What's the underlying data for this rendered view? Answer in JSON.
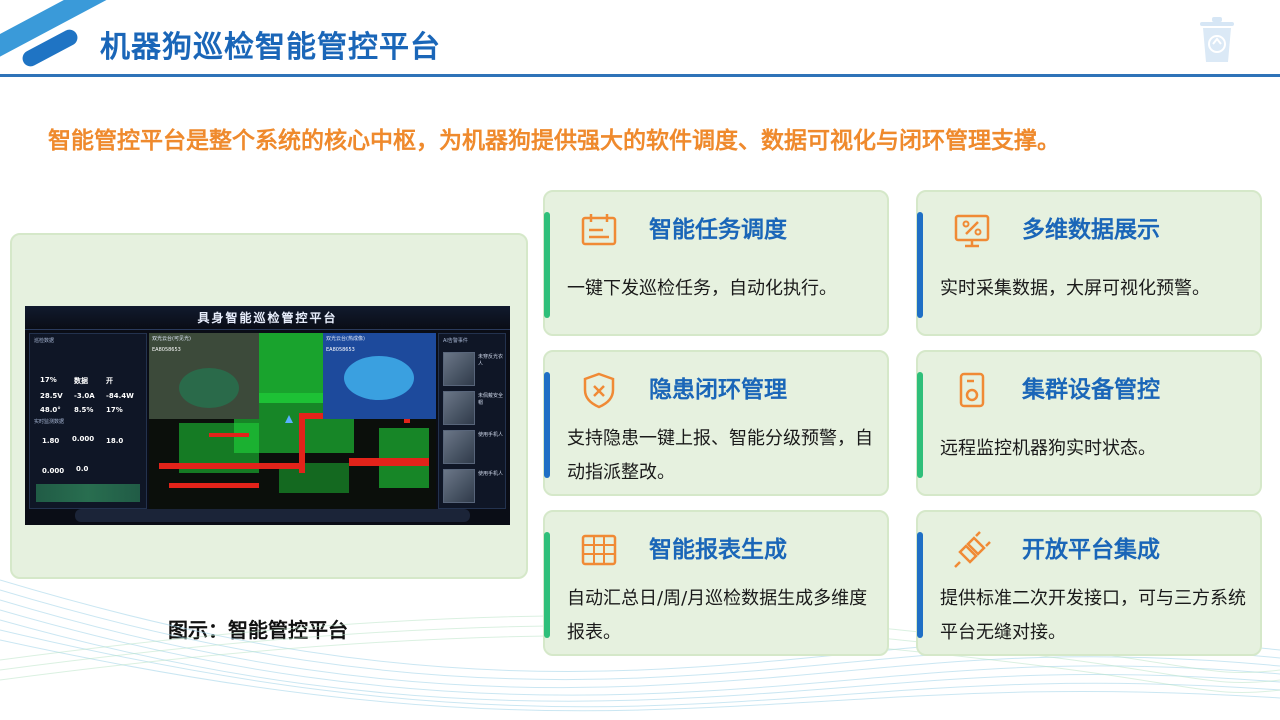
{
  "header": {
    "title": "机器狗巡检智能管控平台"
  },
  "subtitle": "智能管控平台是整个系统的核心中枢，为机器狗提供强大的软件调度、数据可视化与闭环管理支撑。",
  "figure": {
    "caption": "图示：智能管控平台",
    "dashboard_title": "具身智能巡检管控平台",
    "left_panel": {
      "section1": "巡检数据",
      "section2": "实时监测数据",
      "stat_values": [
        "17%",
        "数据",
        "开",
        "28.5V",
        "-3.0A",
        "-84.4W",
        "48.0°",
        "8.5%",
        "17%"
      ],
      "gas_values": [
        "1.80",
        "0.000",
        "18.0",
        "0.000",
        "0.0"
      ]
    },
    "cameras": [
      {
        "label": "双光云台(可见光)",
        "id": "EA8058653"
      },
      {
        "label": "双光云台(热成像)",
        "id": "EA8058653"
      }
    ],
    "alarm_panel": {
      "title": "AI告警事件",
      "items": [
        "未穿反光衣人",
        "未佩戴安全帽",
        "使用手机人",
        "使用手机人"
      ]
    }
  },
  "cards": [
    {
      "icon": "calendar-icon",
      "title": "智能任务调度",
      "desc": "一键下发巡检任务，自动化执行。",
      "accent": "#2fbf7a"
    },
    {
      "icon": "monitor-chart-icon",
      "title": "多维数据展示",
      "desc": "实时采集数据，大屏可视化预警。",
      "accent": "#1f6fc5"
    },
    {
      "icon": "shield-x-icon",
      "title": "隐患闭环管理",
      "desc": "支持隐患一键上报、智能分级预警，自动指派整改。",
      "accent": "#1f6fc5"
    },
    {
      "icon": "device-icon",
      "title": "集群设备管控",
      "desc": "远程监控机器狗实时状态。",
      "accent": "#2fbf7a"
    },
    {
      "icon": "grid-table-icon",
      "title": "智能报表生成",
      "desc": "自动汇总日/周/月巡检数据生成多维度报表。",
      "accent": "#2fbf7a"
    },
    {
      "icon": "plug-icon",
      "title": "开放平台集成",
      "desc": "提供标准二次开发接口，可与三方系统平台无缝对接。",
      "accent": "#1f6fc5"
    }
  ],
  "colors": {
    "title_blue": "#1a66b8",
    "subtitle_orange": "#ef8a2d",
    "icon_orange": "#f08a35",
    "card_bg": "#e6f1df"
  }
}
